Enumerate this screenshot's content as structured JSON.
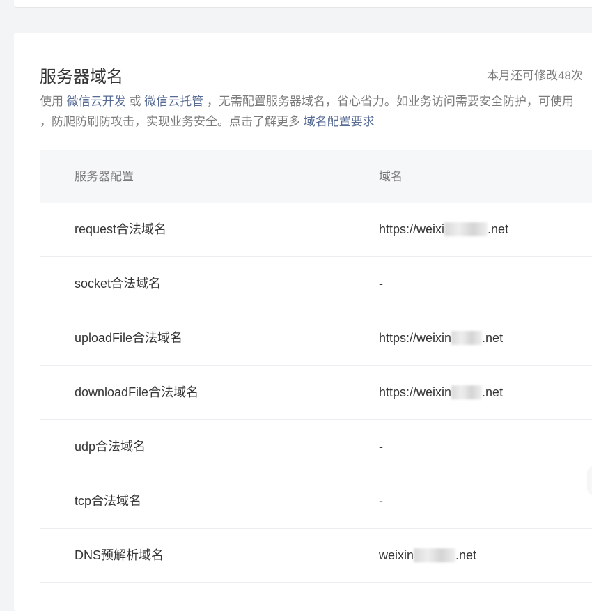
{
  "section": {
    "title": "服务器域名",
    "quota": "本月还可修改48次",
    "desc_prefix": "使用 ",
    "link_cloud_dev": "微信云开发",
    "desc_or": " 或 ",
    "link_cloud_host": "微信云托管",
    "desc_mid": " ，无需配置服务器域名，省心省力。如业务访问需要安全防护，可使用",
    "desc_line2": "，防爬防刷防攻击，实现业务安全。点击了解更多 ",
    "link_domain_req": "域名配置要求"
  },
  "table": {
    "headers": [
      "服务器配置",
      "域名"
    ],
    "rows": [
      {
        "config": "request合法域名",
        "domain_prefix": "https://weixi",
        "domain_suffix": ".net",
        "masked": true
      },
      {
        "config": "socket合法域名",
        "domain_prefix": "-",
        "domain_suffix": "",
        "masked": false
      },
      {
        "config": "uploadFile合法域名",
        "domain_prefix": "https://weixin",
        "domain_suffix": ".net",
        "masked": true
      },
      {
        "config": "downloadFile合法域名",
        "domain_prefix": "https://weixin",
        "domain_suffix": ".net",
        "masked": true
      },
      {
        "config": "udp合法域名",
        "domain_prefix": "-",
        "domain_suffix": "",
        "masked": false
      },
      {
        "config": "tcp合法域名",
        "domain_prefix": "-",
        "domain_suffix": "",
        "masked": false
      },
      {
        "config": "DNS预解析域名",
        "domain_prefix": "weixin",
        "domain_suffix": ".net",
        "masked": true
      }
    ]
  },
  "colors": {
    "link": "#576b95",
    "text": "#353535",
    "muted": "#7b7b7b",
    "header_bg": "#f6f7f8",
    "page_bg": "#f3f4f5"
  }
}
